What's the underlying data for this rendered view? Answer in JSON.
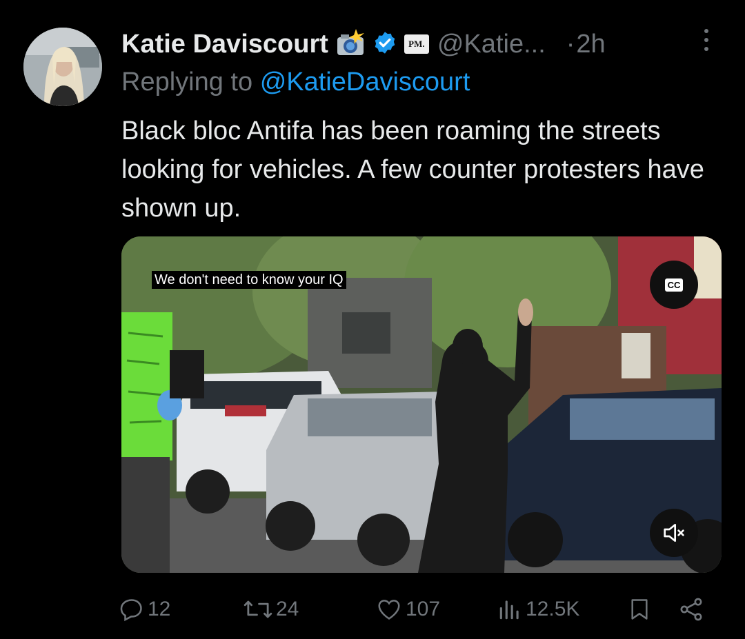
{
  "author": {
    "name": "Katie Daviscourt",
    "camera_badge_icon": "camera-flash-emoji",
    "verified_icon": "verified-badge-blue",
    "affiliate_badge": "PM.",
    "handle": "@Katie...",
    "separator": "·",
    "time": "2h"
  },
  "reply": {
    "prefix": "Replying to",
    "mention": "@KatieDaviscourt"
  },
  "tweet": {
    "text": "Black bloc Antifa has been roaming the streets looking for vehicles. A few counter protesters have shown up."
  },
  "media": {
    "caption": "We don't need to know your IQ",
    "cc_label": "CC",
    "mute_icon": "speaker-muted-icon"
  },
  "actions": {
    "replies": "12",
    "reposts": "24",
    "likes": "107",
    "views": "12.5K"
  },
  "colors": {
    "background": "#000000",
    "text": "#e7e9ea",
    "muted": "#71767b",
    "link": "#1d9bf0",
    "verified": "#1d9bf0"
  }
}
